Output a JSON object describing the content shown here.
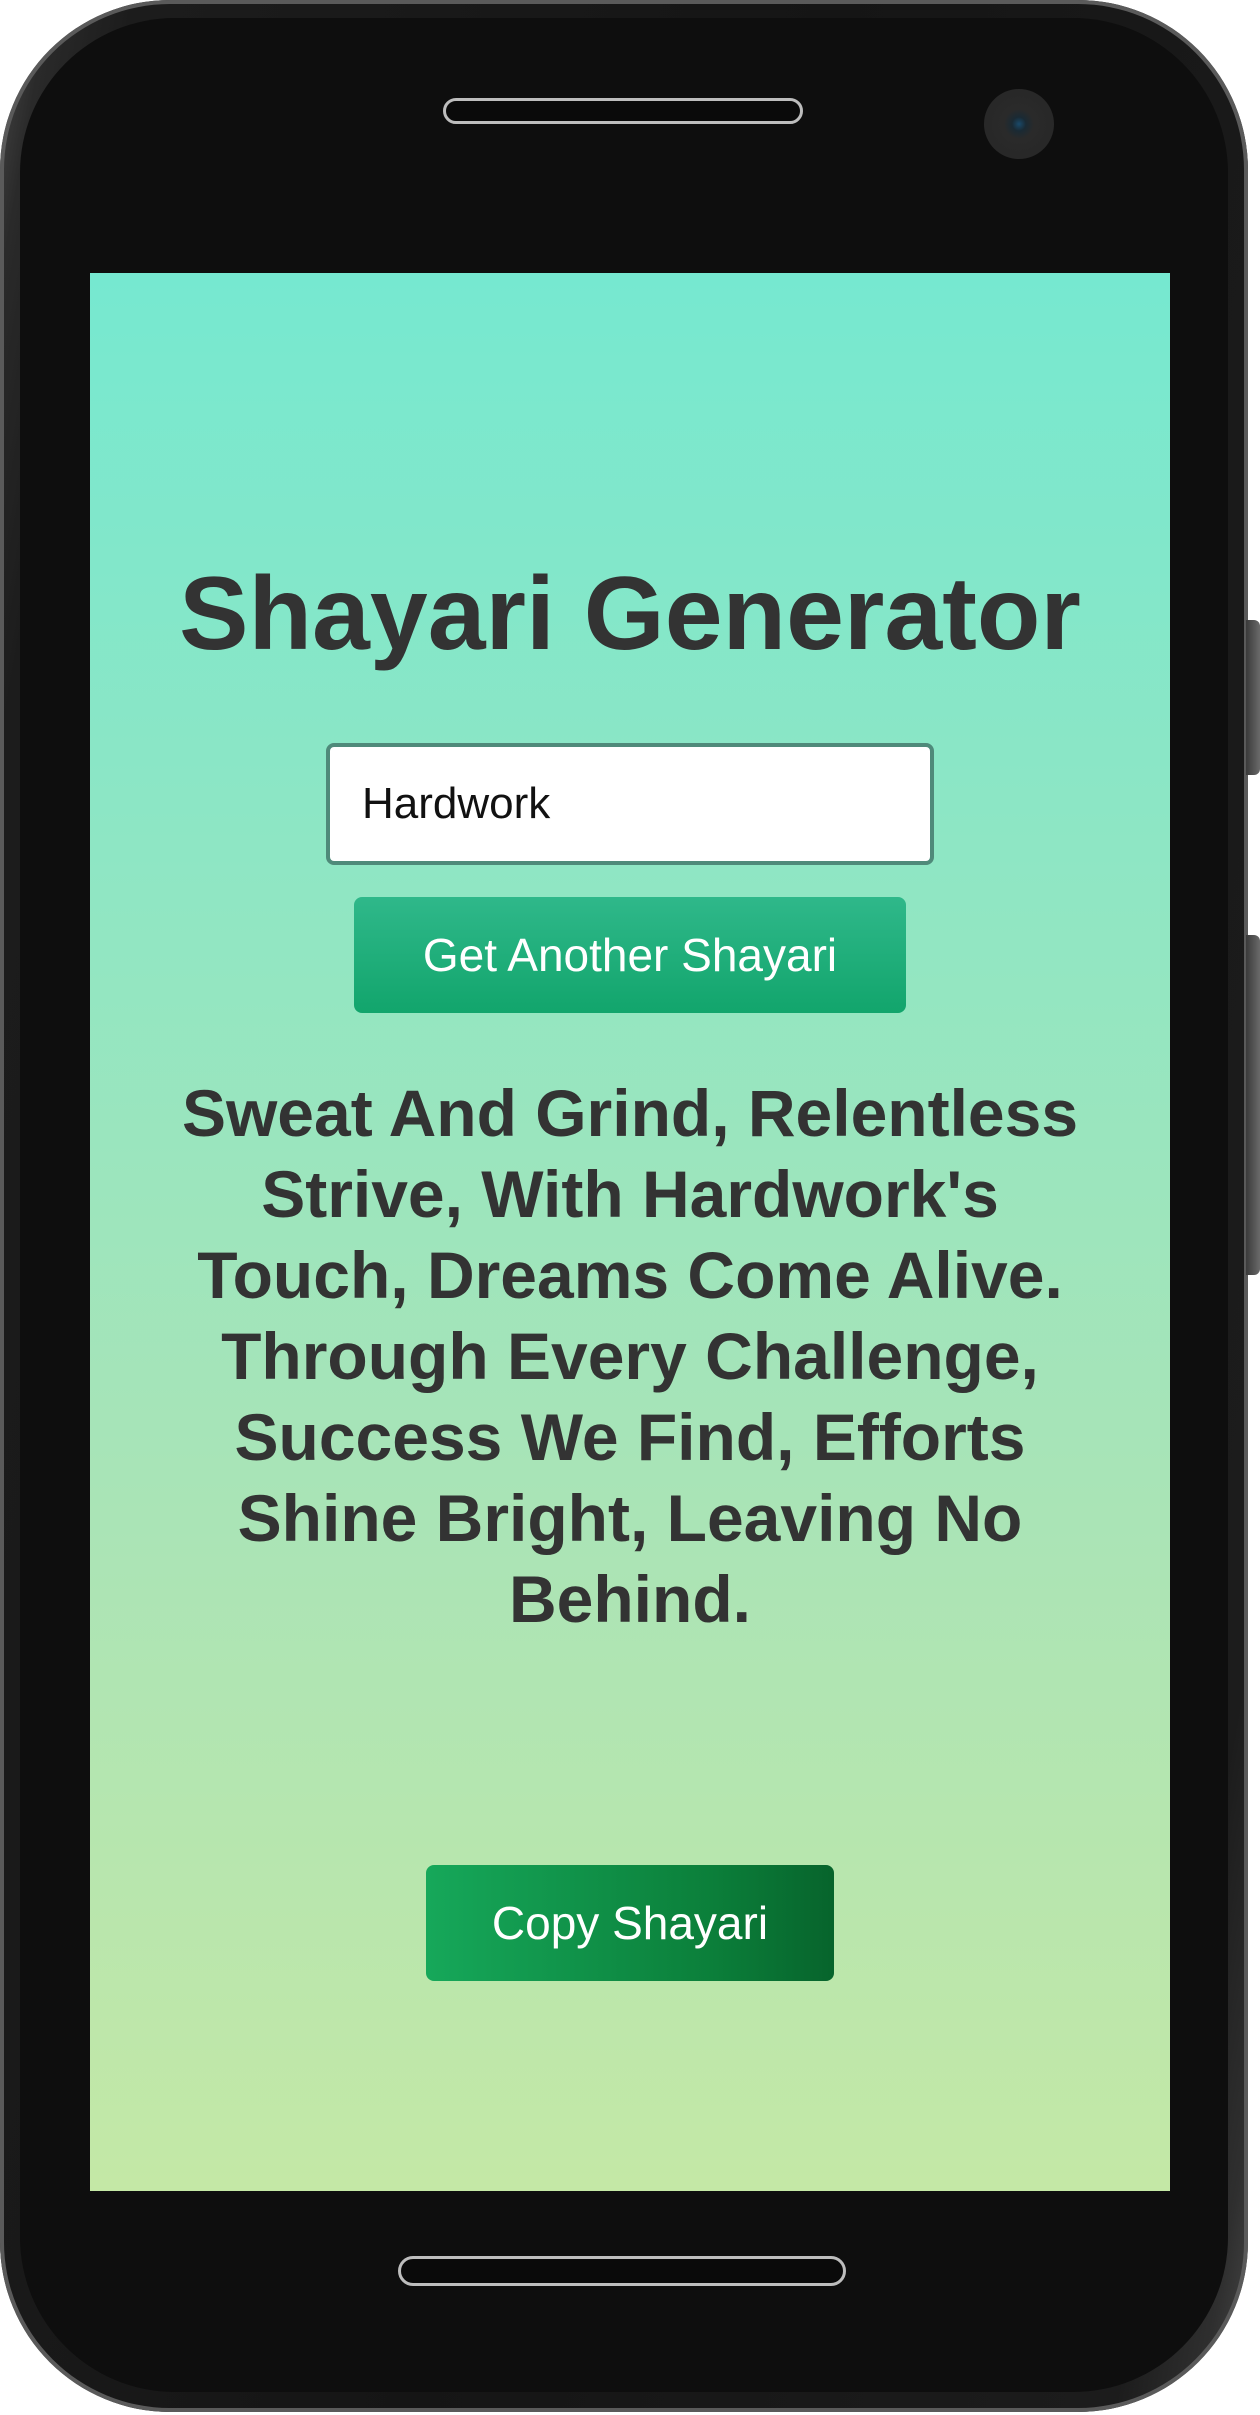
{
  "app": {
    "title": "Shayari Generator"
  },
  "topic_input": {
    "value": "Hardwork"
  },
  "buttons": {
    "another_label": "Get Another Shayari",
    "copy_label": "Copy Shayari"
  },
  "shayari": {
    "text": "Sweat And Grind, Relentless Strive, With Hardwork's Touch, Dreams Come Alive. Through Every Challenge, Success We Find, Efforts Shine Bright, Leaving No Behind."
  },
  "colors": {
    "screen_gradient_top": "#76e8d0",
    "screen_gradient_bottom": "#c4e8a6",
    "another_button": "#12a56c",
    "copy_button": "#0b7f3a",
    "text": "#333333"
  }
}
